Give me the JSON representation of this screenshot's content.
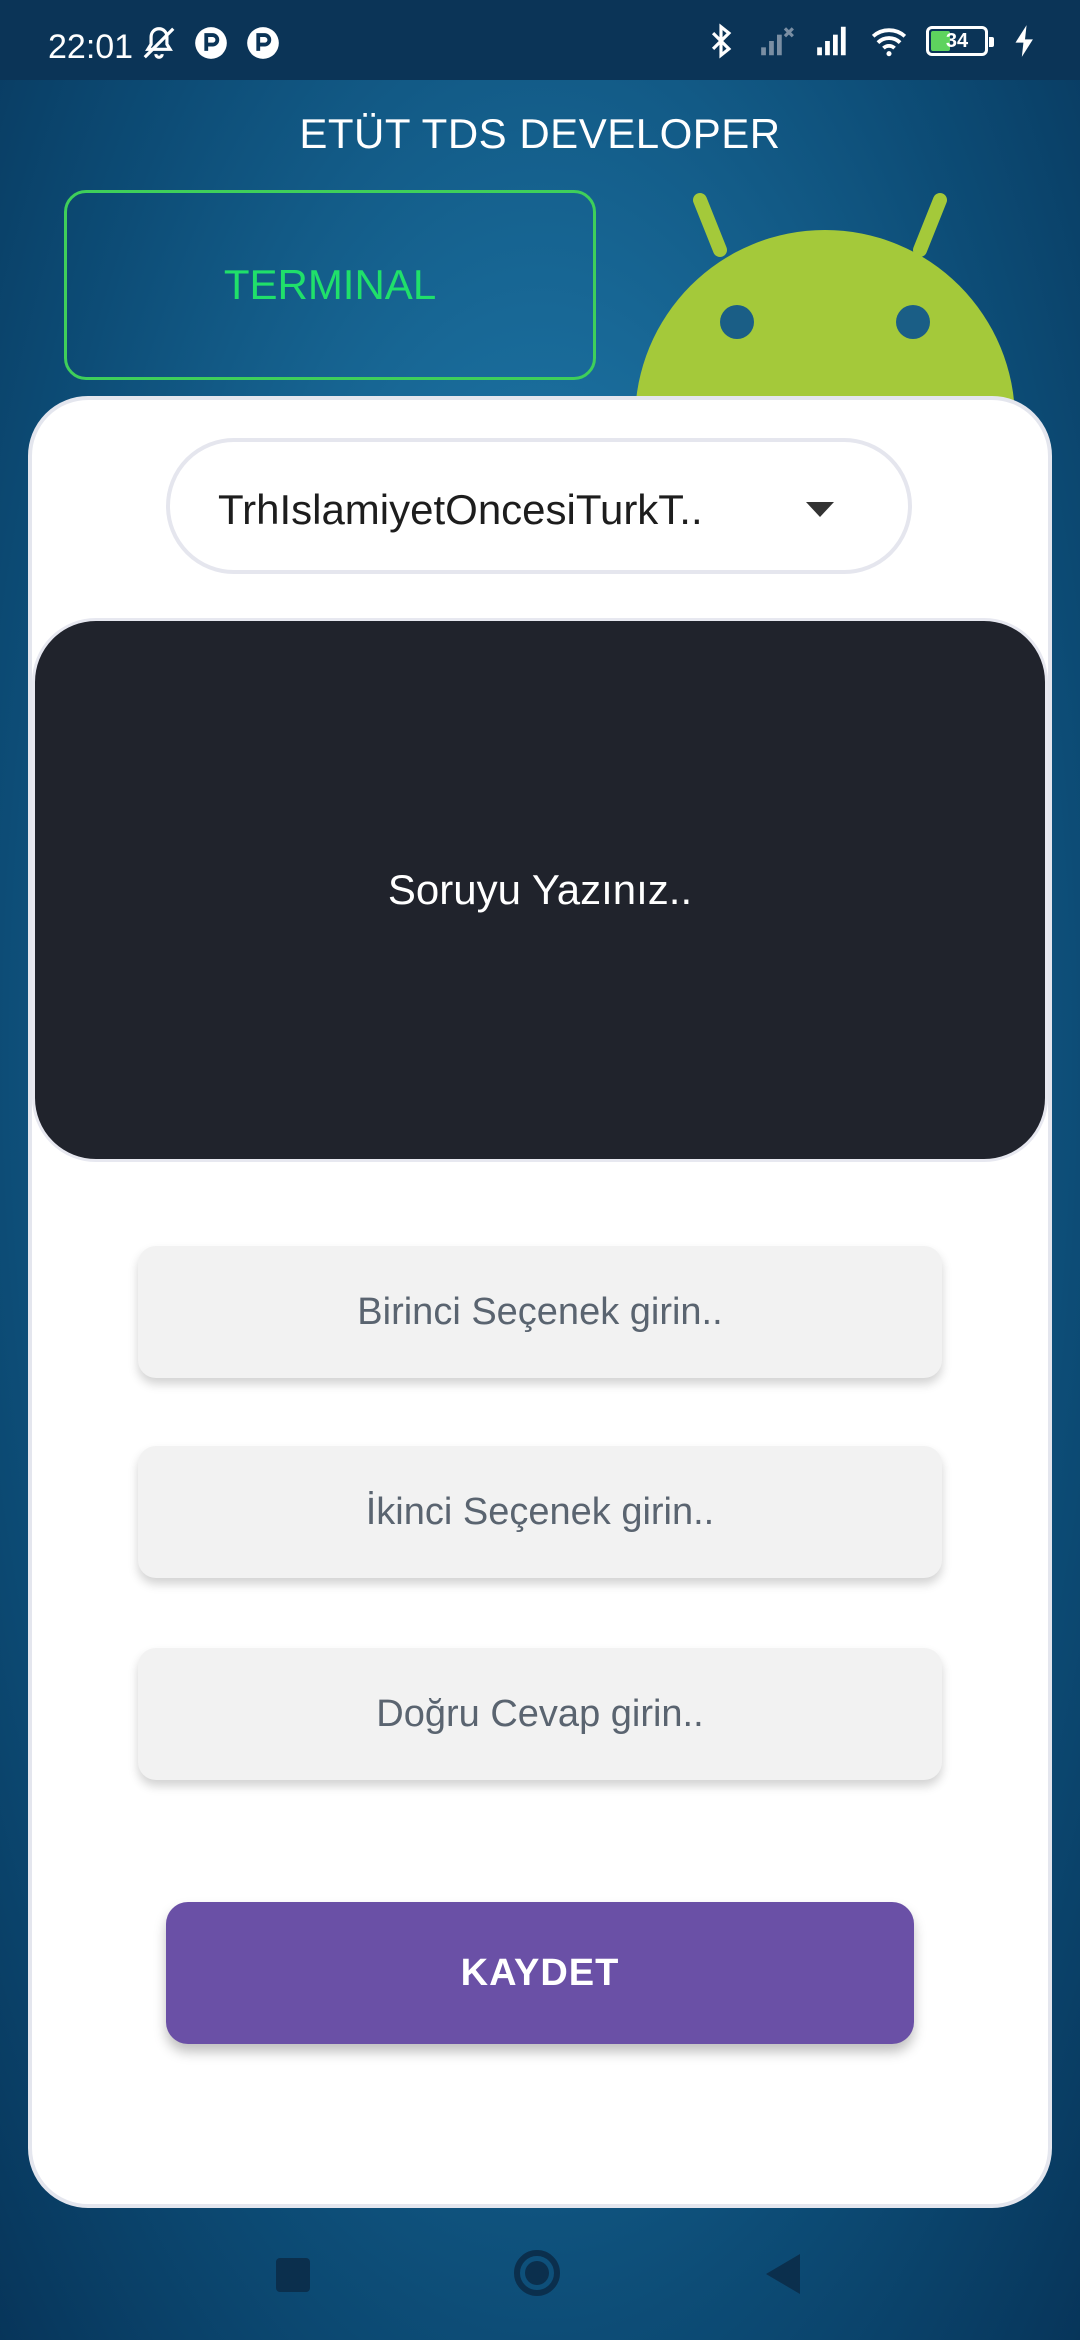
{
  "status_bar": {
    "time": "22:01",
    "battery_percent": "34",
    "icons": [
      "bell-off-icon",
      "r-app-icon",
      "r-app-icon",
      "bluetooth-icon",
      "signal-icon",
      "signal-icon",
      "wifi-icon",
      "battery-icon",
      "charging-icon"
    ]
  },
  "header": {
    "title": "ETÜT TDS DEVELOPER",
    "terminal_label": "TERMINAL"
  },
  "form": {
    "category_selected": "TrhIslamiyetOncesiTurkT..",
    "question_placeholder": "Soruyu Yazınız..",
    "option1_placeholder": "Birinci Seçenek girin..",
    "option2_placeholder": "İkinci Seçenek girin..",
    "correct_placeholder": "Doğru Cevap girin..",
    "save_label": "KAYDET"
  },
  "colors": {
    "accent": "#6a50a6",
    "terminal_green": "#20e06a",
    "android_green": "#a4c93a",
    "question_bg": "#20232c"
  }
}
